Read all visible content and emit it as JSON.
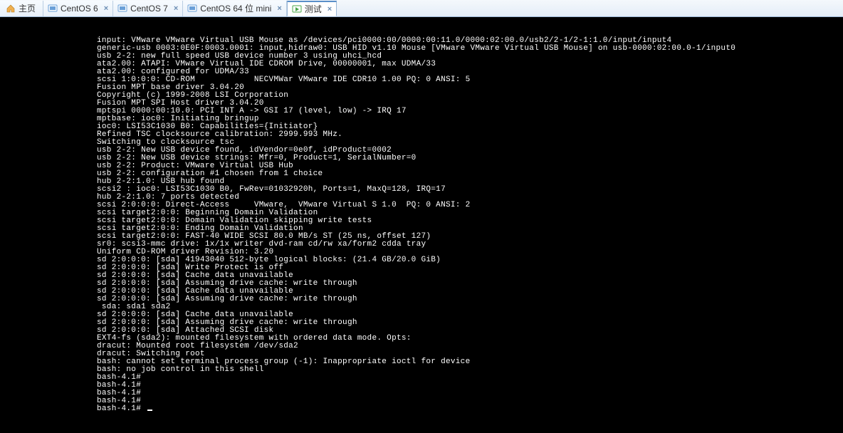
{
  "tabs": {
    "home": {
      "label": "主页"
    },
    "t1": {
      "label": "CentOS 6"
    },
    "t2": {
      "label": "CentOS 7"
    },
    "t3": {
      "label": "CentOS 64 位 mini"
    },
    "t4": {
      "label": "测试"
    }
  },
  "close_glyph": "×",
  "terminal_lines": [
    "input: VMware VMware Virtual USB Mouse as /devices/pci0000:00/0000:00:11.0/0000:02:00.0/usb2/2-1/2-1:1.0/input/input4",
    "generic-usb 0003:0E0F:0003.0001: input,hidraw0: USB HID v1.10 Mouse [VMware VMware Virtual USB Mouse] on usb-0000:02:00.0-1/input0",
    "usb 2-2: new full speed USB device number 3 using uhci_hcd",
    "ata2.00: ATAPI: VMware Virtual IDE CDROM Drive, 00000001, max UDMA/33",
    "ata2.00: configured for UDMA/33",
    "scsi 1:0:0:0: CD-ROM            NECVMWar VMware IDE CDR10 1.00 PQ: 0 ANSI: 5",
    "Fusion MPT base driver 3.04.20",
    "Copyright (c) 1999-2008 LSI Corporation",
    "Fusion MPT SPI Host driver 3.04.20",
    "mptspi 0000:00:10.0: PCI INT A -> GSI 17 (level, low) -> IRQ 17",
    "mptbase: ioc0: Initiating bringup",
    "ioc0: LSI53C1030 B0: Capabilities={Initiator}",
    "Refined TSC clocksource calibration: 2999.993 MHz.",
    "Switching to clocksource tsc",
    "usb 2-2: New USB device found, idVendor=0e0f, idProduct=0002",
    "usb 2-2: New USB device strings: Mfr=0, Product=1, SerialNumber=0",
    "usb 2-2: Product: VMware Virtual USB Hub",
    "usb 2-2: configuration #1 chosen from 1 choice",
    "hub 2-2:1.0: USB hub found",
    "scsi2 : ioc0: LSI53C1030 B0, FwRev=01032920h, Ports=1, MaxQ=128, IRQ=17",
    "hub 2-2:1.0: 7 ports detected",
    "scsi 2:0:0:0: Direct-Access     VMware,  VMware Virtual S 1.0  PQ: 0 ANSI: 2",
    "scsi target2:0:0: Beginning Domain Validation",
    "scsi target2:0:0: Domain Validation skipping write tests",
    "scsi target2:0:0: Ending Domain Validation",
    "scsi target2:0:0: FAST-40 WIDE SCSI 80.0 MB/s ST (25 ns, offset 127)",
    "sr0: scsi3-mmc drive: 1x/1x writer dvd-ram cd/rw xa/form2 cdda tray",
    "Uniform CD-ROM driver Revision: 3.20",
    "sd 2:0:0:0: [sda] 41943040 512-byte logical blocks: (21.4 GB/20.0 GiB)",
    "sd 2:0:0:0: [sda] Write Protect is off",
    "sd 2:0:0:0: [sda] Cache data unavailable",
    "sd 2:0:0:0: [sda] Assuming drive cache: write through",
    "sd 2:0:0:0: [sda] Cache data unavailable",
    "sd 2:0:0:0: [sda] Assuming drive cache: write through",
    " sda: sda1 sda2",
    "sd 2:0:0:0: [sda] Cache data unavailable",
    "sd 2:0:0:0: [sda] Assuming drive cache: write through",
    "sd 2:0:0:0: [sda] Attached SCSI disk",
    "EXT4-fs (sda2): mounted filesystem with ordered data mode. Opts:",
    "dracut: Mounted root filesystem /dev/sda2",
    "dracut: Switching root",
    "bash: cannot set terminal process group (-1): Inappropriate ioctl for device",
    "bash: no job control in this shell",
    "bash-4.1#",
    "bash-4.1#",
    "bash-4.1#",
    "bash-4.1#",
    "bash-4.1# "
  ]
}
